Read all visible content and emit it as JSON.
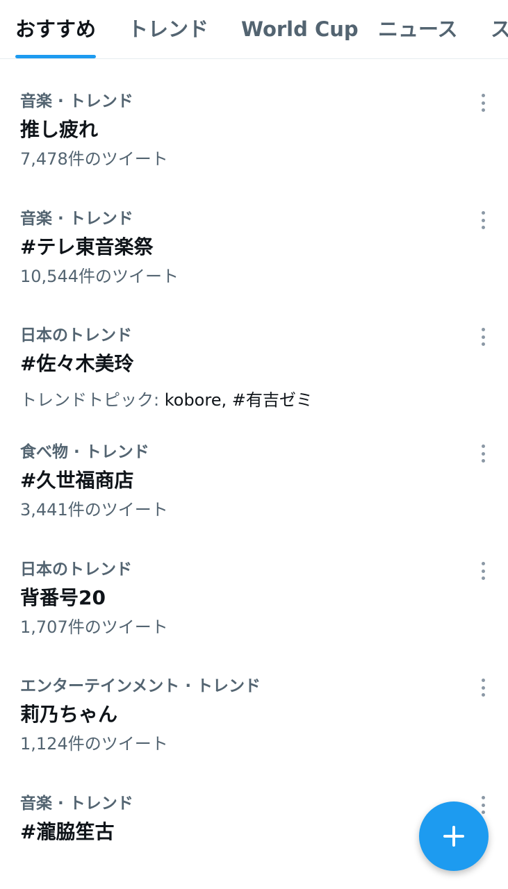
{
  "tabs": [
    {
      "label": "おすすめ",
      "active": true
    },
    {
      "label": "トレンド",
      "active": false
    },
    {
      "label": "World Cup",
      "active": false
    },
    {
      "label": "ニュース",
      "active": false
    },
    {
      "label": "ス",
      "active": false
    }
  ],
  "trends": [
    {
      "context": "音楽 · トレンド",
      "name": "推し疲れ",
      "meta": "7,478件のツイート"
    },
    {
      "context": "音楽 · トレンド",
      "name": "#テレ東音楽祭",
      "meta": "10,544件のツイート"
    },
    {
      "context": "日本のトレンド",
      "name": "#佐々木美玲",
      "meta_prefix": "トレンドトピック: ",
      "meta_topics": "kobore, #有吉ゼミ"
    },
    {
      "context": "食べ物 · トレンド",
      "name": "#久世福商店",
      "meta": "3,441件のツイート"
    },
    {
      "context": "日本のトレンド",
      "name": "背番号20",
      "meta": "1,707件のツイート"
    },
    {
      "context": "エンターテインメント · トレンド",
      "name": "莉乃ちゃん",
      "meta": "1,124件のツイート"
    },
    {
      "context": "音楽 · トレンド",
      "name": "#瀧脇笙古"
    }
  ],
  "icons": {
    "more": "more-vertical-icon",
    "compose": "plus-icon"
  },
  "colors": {
    "accent": "#1d9bf0",
    "secondary_text": "#536471",
    "primary_text": "#0f1419"
  }
}
